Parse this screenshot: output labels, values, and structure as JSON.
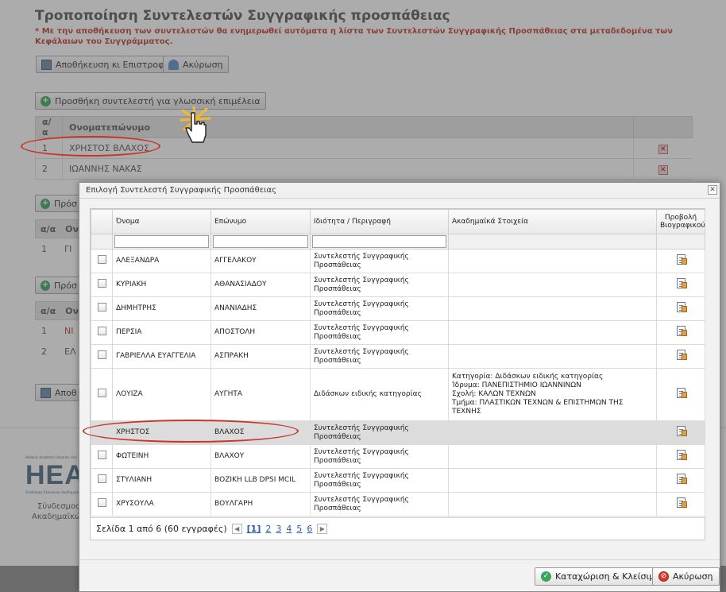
{
  "background_page": {
    "title": "Τροποποίηση Συντελεστών Συγγραφικής προσπάθειας",
    "note": "* Με την αποθήκευση των συντελεστών θα ενημερωθεί αυτόματα η λίστα των Συντελεστών Συγγραφικής Προσπάθειας στα μεταδεδομένα των Κεφάλαιων του Συγγράμματος.",
    "save_return_label": "Αποθήκευση κι Επιστροφή",
    "cancel_label": "Ακύρωση",
    "add_language_editor_label": "Προσθήκη συντελεστή για γλωσσική επιμέλεια",
    "table_headers": {
      "index": "α/α",
      "name": "Ονοματεπώνυμο"
    },
    "rows": [
      {
        "index": "1",
        "name": "ΧΡΗΣΤΟΣ ΒΛΑΧΟΣ"
      },
      {
        "index": "2",
        "name": "ΙΩΑΝΝΗΣ ΝΑΚΑΣ"
      }
    ],
    "partial_add_1": "Πρόσ",
    "partial_header_index": "α/α",
    "partial_header_name": "Ον",
    "partial_row_1_index": "1",
    "partial_row_1_name": "ΓΙ",
    "partial_add_2": "Πρόσ",
    "partial_row_a_index": "1",
    "partial_row_a_name": "ΝΙ",
    "partial_row_b_index": "2",
    "partial_row_b_name": "ΕΛ",
    "partial_save": "Αποθ",
    "footer_logo": "HEAL",
    "footer_logo_top": "Hellenic Academic Libraries Link",
    "footer_logo_sub": "Σύνδεσμος Ελληνικών Ακαδημαϊκών Βιβλιοθηκών",
    "footer_text_1": "Σύνδεσμος",
    "footer_text_2": "Ακαδημαϊκών"
  },
  "dialog": {
    "title": "Επιλογή Συντελεστή Συγγραφικής Προσπάθειας",
    "close_glyph": "✕",
    "columns": {
      "first_name": "Όνομα",
      "last_name": "Επώνυμο",
      "role": "Ιδιότητα / Περιγραφή",
      "academic": "Ακαδημαϊκά Στοιχεία",
      "bio": "Προβολή Βιογραφικού"
    },
    "rows": [
      {
        "first_name": "ΑΛΕΞΑΝΔΡΑ",
        "last_name": "ΑΓΓΕΛΑΚΟΥ",
        "role": "Συντελεστής Συγγραφικής Προσπάθειας",
        "academic": []
      },
      {
        "first_name": "ΚΥΡΙΑΚΗ",
        "last_name": "ΑΘΑΝΑΣΙΑΔΟΥ",
        "role": "Συντελεστής Συγγραφικής Προσπάθειας",
        "academic": []
      },
      {
        "first_name": "ΔΗΜΗΤΡΗΣ",
        "last_name": "ΑΝΑΝΙΑΔΗΣ",
        "role": "Συντελεστής Συγγραφικής Προσπάθειας",
        "academic": []
      },
      {
        "first_name": "ΠΕΡΣΙΑ",
        "last_name": "ΑΠΟΣΤΟΛΗ",
        "role": "Συντελεστής Συγγραφικής Προσπάθειας",
        "academic": []
      },
      {
        "first_name": "ΓΑΒΡΙΕΛΛΑ ΕΥΑΓΓΕΛΙΑ",
        "last_name": "ΑΣΠΡΑΚΗ",
        "role": "Συντελεστής Συγγραφικής Προσπάθειας",
        "academic": []
      },
      {
        "first_name": "ΛΟΥΙΖΑ",
        "last_name": "ΑΥΓΗΤΑ",
        "role": "Διδάσκων ειδικής κατηγορίας",
        "academic": [
          "Κατηγορία: Διδάσκων ειδικής κατηγορίας",
          "Ίδρυμα: ΠΑΝΕΠΙΣΤΗΜΙΟ ΙΩΑΝΝΙΝΩΝ",
          "Σχολή: ΚΑΛΩΝ ΤΕΧΝΩΝ",
          "Τμήμα: ΠΛΑΣΤΙΚΩΝ ΤΕΧΝΩΝ & ΕΠΙΣΤΗΜΩΝ ΤΗΣ ΤΕΧΝΗΣ"
        ]
      },
      {
        "first_name": "ΧΡΗΣΤΟΣ",
        "last_name": "ΒΛΑΧΟΣ",
        "role": "Συντελεστής Συγγραφικής Προσπάθειας",
        "academic": [],
        "selected": true
      },
      {
        "first_name": "ΦΩΤΕΙΝΗ",
        "last_name": "ΒΛΑΧΟΥ",
        "role": "Συντελεστής Συγγραφικής Προσπάθειας",
        "academic": []
      },
      {
        "first_name": "ΣΤΥΛΙΑΝΗ",
        "last_name": "ΒΟΖΙΚΗ LLB DPSI MCIL",
        "role": "Συντελεστής Συγγραφικής Προσπάθειας",
        "academic": []
      },
      {
        "first_name": "ΧΡΥΣΟΥΛΑ",
        "last_name": "ΒΟΥΛΓΑΡΗ",
        "role": "Συντελεστής Συγγραφικής Προσπάθειας",
        "academic": []
      }
    ],
    "pager": {
      "summary": "Σελίδα 1 από 6 (60 εγγραφές)",
      "prev_glyph": "◀",
      "next_glyph": "▶",
      "current": "[1]",
      "pages": [
        "2",
        "3",
        "4",
        "5",
        "6"
      ]
    },
    "submit_label": "Καταχώριση & Κλείσιμο",
    "cancel_label": "Ακύρωση"
  },
  "icons": {
    "save": "floppy-icon",
    "undo": "undo-arrow-icon",
    "add": "plus-circle-icon",
    "delete": "delete-icon",
    "bio": "document-icon",
    "ok": "check-circle-icon",
    "cancel": "no-entry-icon"
  },
  "colors": {
    "highlight_ring": "#c8352c",
    "link": "#2a5bb5",
    "note_text": "#c0392b"
  }
}
